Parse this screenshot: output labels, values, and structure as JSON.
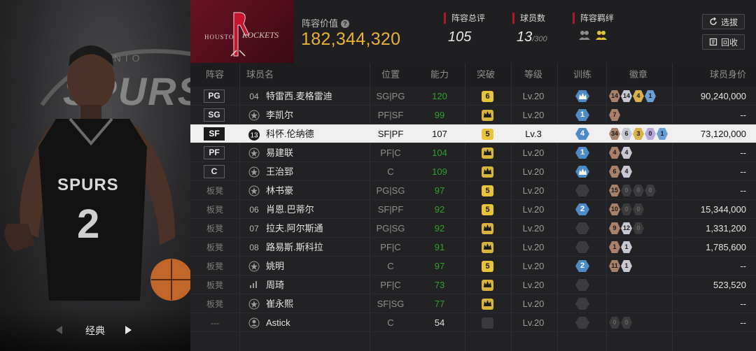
{
  "colors": {
    "accent_gold": "#e8b23a",
    "accent_red": "#b0182c",
    "ability_green": "#2fa12f",
    "selected_row_bg": "#efefef",
    "team_banner": "#6a1222"
  },
  "left_panel": {
    "card_type": "经典",
    "prev_icon": "chevron-left-icon",
    "next_icon": "chevron-right-icon"
  },
  "header": {
    "team_name": "ROCKETS",
    "lineup_value_label": "阵容价值",
    "lineup_value": "182,344,320",
    "stats": {
      "rating_label": "阵容总评",
      "rating_value": "105",
      "players_label": "球员数",
      "players_value": "13",
      "players_max": "/300",
      "bond_label": "阵容羁绊"
    },
    "buttons": {
      "select_label": "选拔",
      "recycle_label": "回收"
    }
  },
  "table": {
    "headers": [
      "阵容",
      "球员名",
      "位置",
      "能力",
      "突破",
      "等级",
      "训练",
      "徽章",
      "球员身价"
    ],
    "rows": [
      {
        "slot": "PG",
        "id": "04",
        "name": "特雷西.麦格雷迪",
        "pos": "SG|PG",
        "ability": "120",
        "break": "6",
        "level": "Lv.20",
        "train": "crown",
        "badges": [
          [
            "14",
            "bronze"
          ],
          [
            "14",
            "silver"
          ],
          [
            "4",
            "gold"
          ],
          [
            "1",
            "blue"
          ]
        ],
        "value": "90,240,000"
      },
      {
        "slot": "SG",
        "id": "star",
        "name": "李凯尔",
        "pos": "PF|SF",
        "ability": "99",
        "break": "crown",
        "level": "Lv.20",
        "train": "1",
        "badges": [
          [
            "7",
            "bronze"
          ]
        ],
        "value": "--"
      },
      {
        "slot": "SF",
        "id": "13",
        "name": "科怀.伦纳德",
        "pos": "SF|PF",
        "ability": "107",
        "break": "5",
        "level": "Lv.3",
        "train": "4",
        "badges": [
          [
            "34",
            "bronze"
          ],
          [
            "6",
            "silver"
          ],
          [
            "3",
            "gold"
          ],
          [
            "0",
            "purple"
          ],
          [
            "1",
            "blue"
          ]
        ],
        "value": "73,120,000",
        "selected": true
      },
      {
        "slot": "PF",
        "id": "star",
        "name": "易建联",
        "pos": "PF|C",
        "ability": "104",
        "break": "crown",
        "level": "Lv.20",
        "train": "1",
        "badges": [
          [
            "4",
            "bronze"
          ],
          [
            "4",
            "silver"
          ]
        ],
        "value": "--"
      },
      {
        "slot": "C",
        "id": "star",
        "name": "王治郅",
        "pos": "C",
        "ability": "109",
        "break": "crown",
        "level": "Lv.20",
        "train": "crown",
        "badges": [
          [
            "6",
            "bronze"
          ],
          [
            "4",
            "silver"
          ]
        ],
        "value": "--"
      },
      {
        "slot": "板凳",
        "id": "star",
        "name": "林书豪",
        "pos": "PG|SG",
        "ability": "97",
        "break": "5",
        "level": "Lv.20",
        "train": "grey",
        "badges": [
          [
            "15",
            "bronze"
          ],
          [
            "0",
            "dark"
          ],
          [
            "0",
            "dark"
          ],
          [
            "0",
            "dark"
          ]
        ],
        "value": "--"
      },
      {
        "slot": "板凳",
        "id": "06",
        "name": "肖恩.巴蒂尔",
        "pos": "SF|PF",
        "ability": "92",
        "break": "5",
        "level": "Lv.20",
        "train": "2",
        "badges": [
          [
            "10",
            "bronze"
          ],
          [
            "0",
            "dark"
          ],
          [
            "0",
            "dark"
          ]
        ],
        "value": "15,344,000"
      },
      {
        "slot": "板凳",
        "id": "07",
        "name": "拉夫.阿尔斯通",
        "pos": "PG|SG",
        "ability": "92",
        "break": "crown",
        "level": "Lv.20",
        "train": "grey",
        "badges": [
          [
            "9",
            "bronze"
          ],
          [
            "12",
            "silver"
          ],
          [
            "0",
            "dark"
          ]
        ],
        "value": "1,331,200"
      },
      {
        "slot": "板凳",
        "id": "08",
        "name": "路易斯.斯科拉",
        "pos": "PF|C",
        "ability": "91",
        "break": "crown",
        "level": "Lv.20",
        "train": "grey",
        "badges": [
          [
            "1",
            "bronze"
          ],
          [
            "1",
            "silver"
          ]
        ],
        "value": "1,785,600"
      },
      {
        "slot": "板凳",
        "id": "star",
        "name": "姚明",
        "pos": "C",
        "ability": "97",
        "break": "5",
        "level": "Lv.20",
        "train": "2",
        "badges": [
          [
            "11",
            "bronze"
          ],
          [
            "1",
            "silver"
          ]
        ],
        "value": "--"
      },
      {
        "slot": "板凳",
        "id": "bars",
        "name": "周琦",
        "pos": "PF|C",
        "ability": "73",
        "break": "crown",
        "level": "Lv.20",
        "train": "grey",
        "badges": [],
        "value": "523,520"
      },
      {
        "slot": "板凳",
        "id": "star",
        "name": "崔永熙",
        "pos": "SF|SG",
        "ability": "77",
        "break": "crown",
        "level": "Lv.20",
        "train": "grey",
        "badges": [],
        "value": "--"
      },
      {
        "slot": "---",
        "id": "person",
        "name": "Astick",
        "pos": "C",
        "ability": "54",
        "break": "grey",
        "level": "Lv.20",
        "train": "grey",
        "badges": [
          [
            "0",
            "dark"
          ],
          [
            "0",
            "dark"
          ]
        ],
        "value": "--",
        "ability_white": true
      }
    ]
  }
}
